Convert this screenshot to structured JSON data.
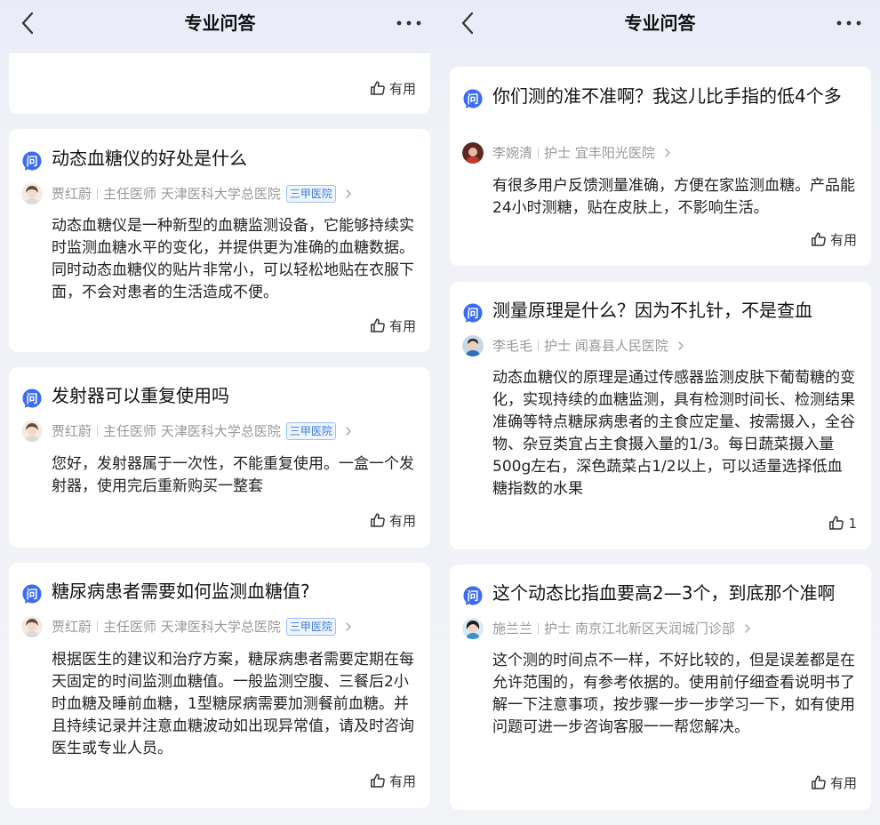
{
  "header": {
    "title": "专业问答"
  },
  "icons": {
    "back": "back-chevron-icon",
    "more": "more-dots-icon",
    "question": "question-badge-icon",
    "thumb": "thumb-up-icon",
    "chevron": "chevron-right-icon"
  },
  "colors": {
    "accent": "#3b6cf6",
    "badge_text": "#3a7be0",
    "muted": "#999999"
  },
  "left": {
    "top_card": {
      "useful": "有用"
    },
    "cards": [
      {
        "question": "动态血糖仪的好处是什么",
        "doctor": {
          "name": "贾红蔚",
          "title": "主任医师",
          "hospital": "天津医科大学总医院",
          "badge": "三甲医院"
        },
        "answer": "动态血糖仪是一种新型的血糖监测设备，它能够持续实时监测血糖水平的变化，并提供更为准确的血糖数据。同时动态血糖仪的贴片非常小，可以轻松地贴在衣服下面，不会对患者的生活造成不便。",
        "useful": "有用"
      },
      {
        "question": "发射器可以重复使用吗",
        "doctor": {
          "name": "贾红蔚",
          "title": "主任医师",
          "hospital": "天津医科大学总医院",
          "badge": "三甲医院"
        },
        "answer": "您好，发射器属于一次性，不能重复使用。一盒一个发射器，使用完后重新购买一整套",
        "useful": "有用"
      },
      {
        "question": "糖尿病患者需要如何监测血糖值?",
        "doctor": {
          "name": "贾红蔚",
          "title": "主任医师",
          "hospital": "天津医科大学总医院",
          "badge": "三甲医院"
        },
        "answer": "根据医生的建议和治疗方案，糖尿病患者需要定期在每天固定的时间监测血糖值。一般监测空腹、三餐后2小时血糖及睡前血糖，1型糖尿病需要加测餐前血糖。并且持续记录并注意血糖波动如出现异常值，请及时咨询医生或专业人员。",
        "useful": "有用"
      }
    ]
  },
  "right": {
    "cards": [
      {
        "question": "你们测的准不准啊？我这儿比手指的低4个多",
        "doctor": {
          "name": "李婉清",
          "title": "护士",
          "hospital": "宜丰阳光医院"
        },
        "answer": "有很多用户反馈测量准确，方便在家监测血糖。产品能24小时测糖，贴在皮肤上，不影响生活。",
        "useful": "有用"
      },
      {
        "question": "测量原理是什么？因为不扎针，不是查血",
        "doctor": {
          "name": "李毛毛",
          "title": "护士",
          "hospital": "闻喜县人民医院"
        },
        "answer": "动态血糖仪的原理是通过传感器监测皮肤下葡萄糖的变化，实现持续的血糖监测，具有检测时间长、检测结果准确等特点糖尿病患者的主食应定量、按需摄入，全谷物、杂豆类宜占主食摄入量的1/3。每日蔬菜摄入量500g左右，深色蔬菜占1/2以上，可以适量选择低血糖指数的水果",
        "useful": "1"
      },
      {
        "question": "这个动态比指血要高2—3个，到底那个准啊",
        "doctor": {
          "name": "施兰兰",
          "title": "护士",
          "hospital": "南京江北新区天润城门诊部"
        },
        "answer": "这个测的时间点不一样，不好比较的，但是误差都是在允许范围的，有参考依据的。使用前仔细查看说明书了解一下注意事项，按步骤一步一步学习一下，如有使用问题可进一步咨询客服一一帮您解决。",
        "useful": "有用"
      }
    ]
  }
}
